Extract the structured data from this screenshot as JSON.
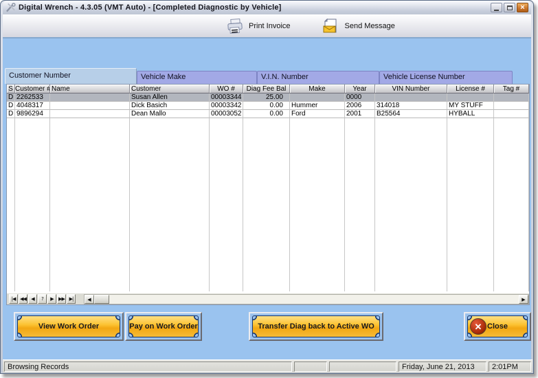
{
  "window": {
    "title": "Digital Wrench - 4.3.05 (VMT Auto) - [Completed Diagnostic by Vehicle]",
    "close_glyph": "×"
  },
  "toolbar": {
    "print_invoice_label": "Print Invoice",
    "send_message_label": "Send Message"
  },
  "tabs": [
    {
      "label": "Customer Number",
      "active": true
    },
    {
      "label": "Vehicle Make",
      "active": false
    },
    {
      "label": "V.I.N. Number",
      "active": false
    },
    {
      "label": "Vehicle License Number",
      "active": false
    }
  ],
  "grid": {
    "columns": [
      "S",
      "Customer #",
      "Name",
      "Customer",
      "WO #",
      "Diag Fee Bal",
      "Make",
      "Year",
      "VIN Number",
      "License #",
      "Tag #"
    ],
    "selected_row_index": 0,
    "rows": [
      [
        "D",
        "2262533",
        "",
        "Susan Allen",
        "00003344",
        "25.00",
        "",
        "0000",
        "",
        "",
        ""
      ],
      [
        "D",
        "4048317",
        "",
        "Dick Basich",
        "00003342",
        "0.00",
        "Hummer",
        "2006",
        "314018",
        "MY STUFF",
        ""
      ],
      [
        "D",
        "9896294",
        "",
        "Dean Mallo",
        "00003052",
        "0.00",
        "Ford",
        "2001",
        "B25564",
        "HYBALL",
        ""
      ]
    ]
  },
  "navigator": {
    "buttons": [
      {
        "name": "nav-first-button",
        "glyph": "|◀"
      },
      {
        "name": "nav-rewind-button",
        "glyph": "◀◀"
      },
      {
        "name": "nav-prior-button",
        "glyph": "◀"
      },
      {
        "name": "nav-help-button",
        "glyph": "?"
      },
      {
        "name": "nav-next-button",
        "glyph": "▶"
      },
      {
        "name": "nav-forward-button",
        "glyph": "▶▶"
      },
      {
        "name": "nav-last-button",
        "glyph": "▶|"
      }
    ],
    "scroll_left_glyph": "◀",
    "scroll_right_glyph": "▶"
  },
  "actions": {
    "view_work_order": "View Work Order",
    "pay_on_work_order": "Pay on Work Order",
    "transfer_diag": "Transfer Diag back to Active WO",
    "close": "Close",
    "close_mark": "✕"
  },
  "statusbar": {
    "status": "Browsing Records",
    "date": "Friday, June 21, 2013",
    "time": "2:01PM"
  },
  "colors": {
    "client_blue": "#9ac3ef",
    "tab_active": "#b7cfe8",
    "tab_inactive": "#a2a9e6",
    "button_gold": "#fcc231",
    "button_outline_navy": "#16356b",
    "selected_row": "#b2b6be",
    "close_red": "#a82c08"
  }
}
